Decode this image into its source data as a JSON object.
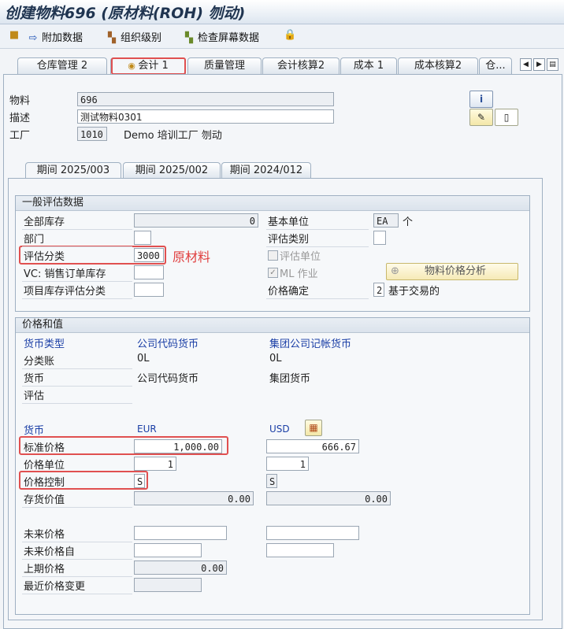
{
  "window": {
    "title": "创建物料696 (原材料(ROH) 刎动)"
  },
  "toolbar": {
    "additional_data": "附加数据",
    "org_levels": "组织级别",
    "check_screen_data": "检查屏幕数据"
  },
  "top_tabs": [
    "仓库管理 2",
    "会计 1",
    "质量管理",
    "会计核算2",
    "成本 1",
    "成本核算2",
    "仓..."
  ],
  "header": {
    "material_label": "物料",
    "material_value": "696",
    "desc_label": "描述",
    "desc_value": "测试物料0301",
    "plant_label": "工厂",
    "plant_value": "1010",
    "plant_name": "Demo 培训工厂 刎动"
  },
  "period_tabs": [
    "期间 2025/003",
    "期间 2025/002",
    "期间 2024/012"
  ],
  "general": {
    "title": "一般评估数据",
    "total_stock_label": "全部库存",
    "total_stock_value": "0",
    "base_unit_label": "基本单位",
    "base_unit_value": "EA",
    "base_unit_text": "个",
    "division_label": "部门",
    "valuation_category_label": "评估类别",
    "valuation_class_label": "评估分类",
    "valuation_class_value": "3000",
    "annotation": "原材料",
    "valuated_unit_label": "评估单位",
    "vc_label": "VC: 销售订单库存",
    "ml_label": "ML 作业",
    "price_analysis_button": "物料价格分析",
    "project_stock_label": "项目库存评估分类",
    "price_determination_label": "价格确定",
    "price_determination_value": "2",
    "price_determination_text": "基于交易的"
  },
  "prices": {
    "title": "价格和值",
    "currency_type_label": "货币类型",
    "col1_header": "公司代码货币",
    "col2_header": "集团公司记帐货币",
    "ledger_label": "分类账",
    "ledger_col1": "0L",
    "ledger_col2": "0L",
    "currency_label": "货币",
    "currency_col1": "公司代码货币",
    "currency_col2": "集团货币",
    "valuation_label": "评估",
    "currency2_label": "货币",
    "cur1": "EUR",
    "cur2": "USD",
    "std_price_label": "标准价格",
    "std_price_1": "1,000.00",
    "std_price_2": "666.67",
    "price_unit_label": "价格单位",
    "price_unit_1": "1",
    "price_unit_2": "1",
    "price_control_label": "价格控制",
    "price_control_1": "S",
    "price_control_2": "S",
    "stock_value_label": "存货价值",
    "stock_value_1": "0.00",
    "stock_value_2": "0.00",
    "future_price_label": "未来价格",
    "future_price_from_label": "未来价格自",
    "prev_price_label": "上期价格",
    "prev_price_1": "0.00",
    "last_change_label": "最近价格变更"
  }
}
